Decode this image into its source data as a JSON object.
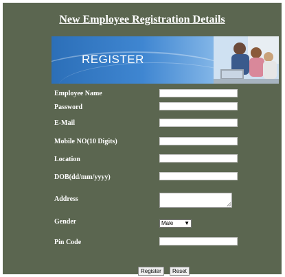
{
  "page": {
    "title": "New Employee Registration Details"
  },
  "banner": {
    "text": "REGISTER",
    "image": "family-at-computer-photo"
  },
  "form": {
    "fields": [
      {
        "label": "Employee Name",
        "value": ""
      },
      {
        "label": "Password",
        "value": ""
      },
      {
        "label": "E-Mail",
        "value": ""
      },
      {
        "label": "Mobile NO(10 Digits)",
        "value": ""
      },
      {
        "label": "Location",
        "value": ""
      },
      {
        "label": "DOB(dd/mm/yyyy)",
        "value": ""
      },
      {
        "label": "Address",
        "value": ""
      },
      {
        "label": "Gender",
        "selected": "Male"
      },
      {
        "label": "Pin Code",
        "value": ""
      }
    ]
  },
  "buttons": {
    "register": "Register",
    "reset": "Reset"
  },
  "colors": {
    "panel_background": "#5b6650",
    "label_text": "#ffffff",
    "banner_blue": "#2c6fb8"
  }
}
